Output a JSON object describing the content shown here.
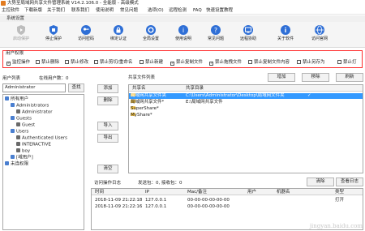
{
  "window": {
    "title": "大势至局域网共享文件管理系统 V14.2.106.0 - 全能版 - 高级模式"
  },
  "menu": [
    "主控软件",
    "下载新版",
    "关于我们",
    "联系我们",
    "使用说明",
    "常见问题",
    "选项(O)",
    "远程检测",
    "FAQ",
    "快速设置教程"
  ],
  "toolbar_group": "系统设置",
  "toolbar": [
    {
      "label": "启动保护",
      "icon": "shield-play-icon",
      "disabled": true
    },
    {
      "label": "停止保护",
      "icon": "shield-stop-icon",
      "disabled": false
    },
    {
      "label": "访问密码",
      "icon": "key-icon",
      "disabled": false
    },
    {
      "label": "绑定认证",
      "icon": "lock-icon",
      "disabled": false
    },
    {
      "label": "全局设置",
      "icon": "gear-icon",
      "disabled": false
    },
    {
      "label": "使用说明",
      "icon": "help-icon",
      "disabled": false
    },
    {
      "label": "常见问题",
      "icon": "question-icon",
      "disabled": false
    },
    {
      "label": "远程协助",
      "icon": "remote-icon",
      "disabled": false
    },
    {
      "label": "关于软件",
      "icon": "info-icon",
      "disabled": false
    },
    {
      "label": "访问官网",
      "icon": "globe-icon",
      "disabled": false
    }
  ],
  "permissions": {
    "title": "用户权限",
    "items": [
      {
        "label": "监控操作",
        "checked": true
      },
      {
        "label": "禁止删除",
        "checked": false
      },
      {
        "label": "禁止修改",
        "checked": false
      },
      {
        "label": "禁止剪切/重命名",
        "checked": false
      },
      {
        "label": "禁止新建",
        "checked": false
      },
      {
        "label": "禁止复制文件",
        "checked": true
      },
      {
        "label": "禁止拖拽文件",
        "checked": true
      },
      {
        "label": "禁止复制文件内容",
        "checked": false
      },
      {
        "label": "禁止另存为",
        "checked": false
      },
      {
        "label": "禁止打",
        "checked": false
      }
    ]
  },
  "users": {
    "list_label": "用户列表",
    "online_label": "在线用户数：0",
    "search_value": "Administrator",
    "search_button": "查找",
    "tree": [
      {
        "label": "所有用户",
        "level": 0,
        "color": "#4a7fd0"
      },
      {
        "label": "Administrators",
        "level": 1,
        "color": "#4a7fd0"
      },
      {
        "label": "Administrator",
        "level": 2,
        "color": "#6a6a6a"
      },
      {
        "label": "Guests",
        "level": 1,
        "color": "#4a7fd0"
      },
      {
        "label": "Guest",
        "level": 2,
        "color": "#6a6a6a"
      },
      {
        "label": "Users",
        "level": 1,
        "color": "#4a7fd0"
      },
      {
        "label": "Authenticated Users",
        "level": 2,
        "color": "#6a6a6a"
      },
      {
        "label": "INTERACTIVE",
        "level": 2,
        "color": "#6a6a6a"
      },
      {
        "label": "boy",
        "level": 2,
        "color": "#6a6a6a"
      },
      {
        "label": "[域用户]",
        "level": 1,
        "color": "#4a7fd0"
      },
      {
        "label": "未连权限",
        "level": 0,
        "color": "#4a7fd0"
      }
    ]
  },
  "middle_buttons": [
    "添加",
    "删除",
    "导入",
    "导出",
    "清空"
  ],
  "shares": {
    "list_label": "共享文件列表",
    "add": "增加",
    "remove": "移除",
    "refresh": "刷新",
    "columns": [
      "共享名",
      "共享目录"
    ],
    "rows": [
      {
        "name": "局域网共享文件夹",
        "path": "C:\\Users\\Administrator\\Desktop\\局域网文件夹",
        "selected": true
      },
      {
        "name": "局域网共享文件*",
        "path": "E:\\局域网共享文件",
        "selected": false
      },
      {
        "name": "SuperShare*",
        "path": "",
        "selected": false
      },
      {
        "name": "MyShare*",
        "path": "",
        "selected": false
      }
    ]
  },
  "log": {
    "title": "访问操作日志",
    "stats": "发送包：0, 接收包：0",
    "clear": "清除",
    "view": "查看日志",
    "columns": [
      "时间",
      "IP",
      "Mac/备注",
      "用户",
      "机器名",
      "类型"
    ],
    "rows": [
      [
        "2018-11-09 21:22:18",
        "127.0.0.1",
        "00-00-00-00-00-00",
        "",
        "",
        "打开"
      ],
      [
        "2018-11-09 21:22:16",
        "127.0.0.1",
        "00-00-00-00-00-00",
        "",
        "",
        ""
      ]
    ]
  },
  "watermark": "jingyan.baidu.com"
}
